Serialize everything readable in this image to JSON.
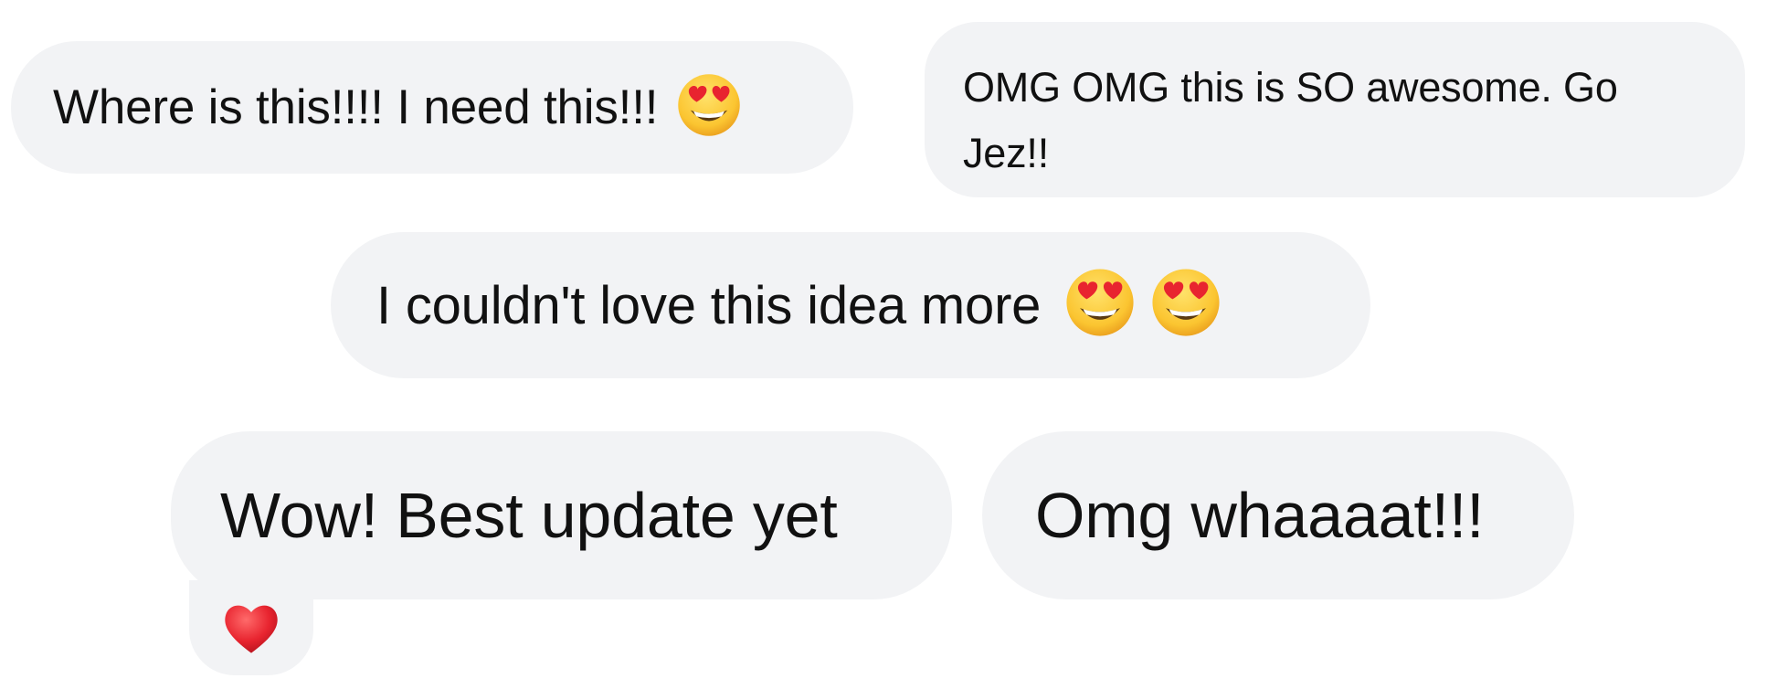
{
  "messages": [
    {
      "text": "Where is this!!!! I need this!!!",
      "emoji": "heart-eyes"
    },
    {
      "text": "OMG OMG this is SO awesome. Go Jez!!"
    },
    {
      "text": "I couldn't love this idea more",
      "emojis": [
        "heart-eyes",
        "heart-eyes"
      ]
    },
    {
      "text": "Wow! Best update yet",
      "reaction": "red-heart"
    },
    {
      "text": "Omg whaaaat!!!"
    }
  ],
  "colors": {
    "bubble": "#f2f3f5",
    "text": "#111111",
    "emoji_face": "#ffcc33",
    "emoji_heart": "#e8242f"
  }
}
